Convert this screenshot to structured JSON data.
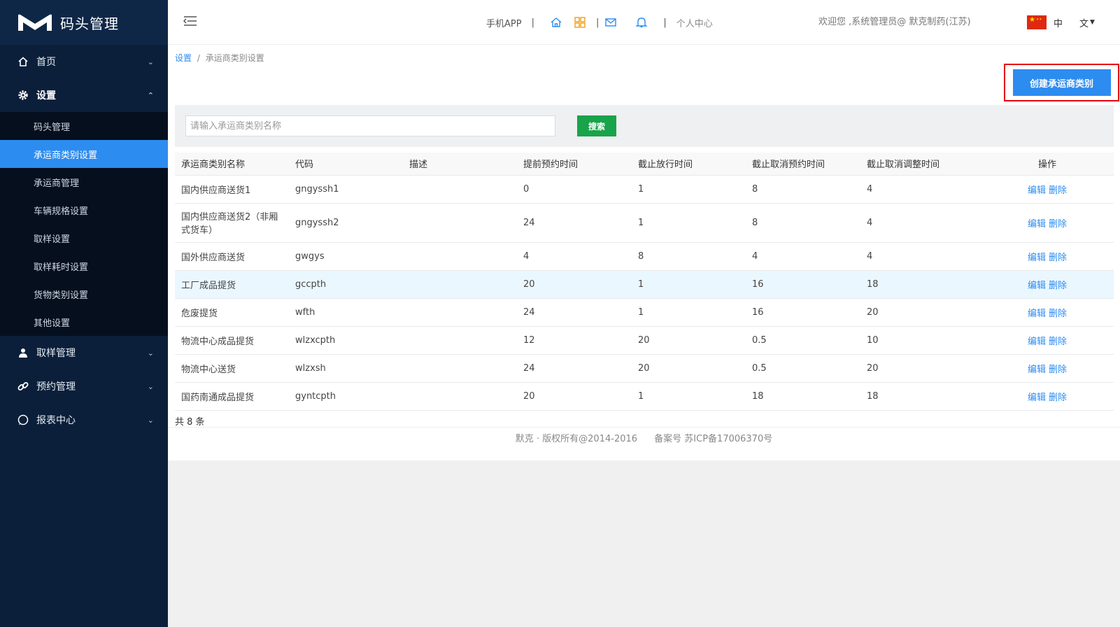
{
  "app": {
    "title": "码头管理"
  },
  "sidebar": {
    "menu": [
      {
        "label": "首页",
        "icon": "home-icon",
        "expanded": false
      },
      {
        "label": "设置",
        "icon": "gear-icon",
        "expanded": true,
        "children": [
          "码头管理",
          "承运商类别设置",
          "承运商管理",
          "车辆规格设置",
          "取样设置",
          "取样耗时设置",
          "货物类别设置",
          "其他设置"
        ],
        "active_child": "承运商类别设置"
      },
      {
        "label": "取样管理",
        "icon": "user-icon",
        "expanded": false
      },
      {
        "label": "预约管理",
        "icon": "link-icon",
        "expanded": false
      },
      {
        "label": "报表中心",
        "icon": "chat-icon",
        "expanded": false
      }
    ]
  },
  "header": {
    "mobile_app": "手机APP",
    "personal_center": "个人中心",
    "welcome": "欢迎您 ,系统管理员@ 默克制药(江苏)",
    "lang_zh": "中",
    "lang_en": "文"
  },
  "breadcrumb": {
    "parent": "设置",
    "separator": "/",
    "current": "承运商类别设置"
  },
  "toolbar": {
    "create_label": "创建承运商类别"
  },
  "search": {
    "placeholder": "请输入承运商类别名称",
    "value": "",
    "button": "搜索"
  },
  "table": {
    "columns": [
      "承运商类别名称",
      "代码",
      "描述",
      "提前预约时间",
      "截止放行时间",
      "截止取消预约时间",
      "截止取消调整时间",
      "操作"
    ],
    "rows": [
      {
        "name": "国内供应商送货1",
        "code": "gngyssh1",
        "desc": "",
        "advance": "0",
        "release": "1",
        "cancel_booking": "8",
        "cancel_adjust": "4"
      },
      {
        "name": "国内供应商送货2（非厢式货车）",
        "code": "gngyssh2",
        "desc": "",
        "advance": "24",
        "release": "1",
        "cancel_booking": "8",
        "cancel_adjust": "4"
      },
      {
        "name": "国外供应商送货",
        "code": "gwgys",
        "desc": "",
        "advance": "4",
        "release": "8",
        "cancel_booking": "4",
        "cancel_adjust": "4"
      },
      {
        "name": "工厂成品提货",
        "code": "gccpth",
        "desc": "",
        "advance": "20",
        "release": "1",
        "cancel_booking": "16",
        "cancel_adjust": "18"
      },
      {
        "name": "危废提货",
        "code": "wfth",
        "desc": "",
        "advance": "24",
        "release": "1",
        "cancel_booking": "16",
        "cancel_adjust": "20"
      },
      {
        "name": "物流中心成品提货",
        "code": "wlzxcpth",
        "desc": "",
        "advance": "12",
        "release": "20",
        "cancel_booking": "0.5",
        "cancel_adjust": "10"
      },
      {
        "name": "物流中心送货",
        "code": "wlzxsh",
        "desc": "",
        "advance": "24",
        "release": "20",
        "cancel_booking": "0.5",
        "cancel_adjust": "20"
      },
      {
        "name": "国药南通成品提货",
        "code": "gyntcpth",
        "desc": "",
        "advance": "20",
        "release": "1",
        "cancel_booking": "18",
        "cancel_adjust": "18"
      }
    ],
    "edit_label": "编辑",
    "delete_label": "删除",
    "total": "共 8 条"
  },
  "footer": {
    "copyright": "默克 · 版权所有@2014-2016",
    "icp": "备案号 苏ICP备17006370号"
  },
  "colors": {
    "sidebar_bg": "#0b1f3a",
    "accent": "#2d8cf0",
    "search_btn": "#19a34a",
    "highlight_border": "#e60012"
  }
}
